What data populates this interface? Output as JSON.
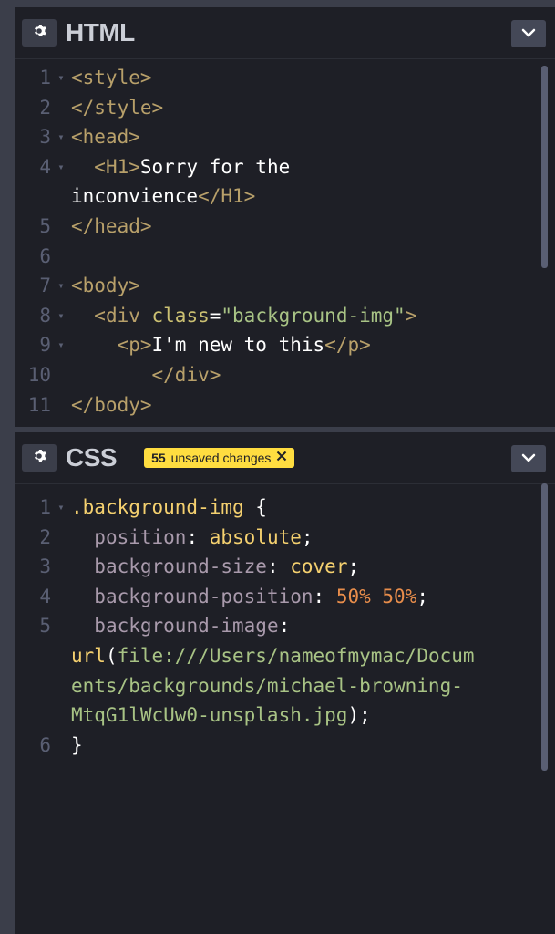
{
  "html_pane": {
    "title": "HTML",
    "lines": [
      {
        "n": "1",
        "fold": true,
        "parts": [
          {
            "c": "tag",
            "t": "<style>"
          }
        ]
      },
      {
        "n": "2",
        "fold": false,
        "parts": [
          {
            "c": "tag",
            "t": "</style>"
          }
        ]
      },
      {
        "n": "3",
        "fold": true,
        "parts": [
          {
            "c": "tag",
            "t": "<head>"
          }
        ]
      },
      {
        "n": "4",
        "fold": true,
        "parts": [
          {
            "c": "plain",
            "t": "  "
          },
          {
            "c": "tag",
            "t": "<H1>"
          },
          {
            "c": "plain",
            "t": "Sorry for the"
          }
        ]
      },
      {
        "n": "",
        "fold": false,
        "parts": [
          {
            "c": "plain",
            "t": "inconvience"
          },
          {
            "c": "tag",
            "t": "</H1>"
          }
        ]
      },
      {
        "n": "5",
        "fold": false,
        "parts": [
          {
            "c": "tag",
            "t": "</head>"
          }
        ]
      },
      {
        "n": "6",
        "fold": false,
        "parts": []
      },
      {
        "n": "7",
        "fold": true,
        "parts": [
          {
            "c": "tag",
            "t": "<body>"
          }
        ]
      },
      {
        "n": "8",
        "fold": true,
        "parts": [
          {
            "c": "plain",
            "t": "  "
          },
          {
            "c": "tag",
            "t": "<div "
          },
          {
            "c": "attr",
            "t": "class"
          },
          {
            "c": "plain",
            "t": "="
          },
          {
            "c": "str",
            "t": "\"background-img\""
          },
          {
            "c": "tag",
            "t": ">"
          }
        ]
      },
      {
        "n": "9",
        "fold": true,
        "parts": [
          {
            "c": "plain",
            "t": "    "
          },
          {
            "c": "tag",
            "t": "<p>"
          },
          {
            "c": "plain",
            "t": "I'm new to this"
          },
          {
            "c": "tag",
            "t": "</p>"
          }
        ]
      },
      {
        "n": "10",
        "fold": false,
        "parts": [
          {
            "c": "plain",
            "t": "       "
          },
          {
            "c": "tag",
            "t": "</div>"
          }
        ]
      },
      {
        "n": "11",
        "fold": false,
        "parts": [
          {
            "c": "tag",
            "t": "</body>"
          }
        ]
      }
    ]
  },
  "css_pane": {
    "title": "CSS",
    "badge_count": "55",
    "badge_label": "unsaved changes",
    "lines": [
      {
        "n": "1",
        "fold": true,
        "parts": [
          {
            "c": "sel",
            "t": ".background-img"
          },
          {
            "c": "plain",
            "t": " {"
          }
        ]
      },
      {
        "n": "2",
        "fold": false,
        "parts": [
          {
            "c": "plain",
            "t": "  "
          },
          {
            "c": "prop",
            "t": "position"
          },
          {
            "c": "plain",
            "t": ": "
          },
          {
            "c": "val",
            "t": "absolute"
          },
          {
            "c": "plain",
            "t": ";"
          }
        ]
      },
      {
        "n": "3",
        "fold": false,
        "parts": [
          {
            "c": "plain",
            "t": "  "
          },
          {
            "c": "prop",
            "t": "background-size"
          },
          {
            "c": "plain",
            "t": ": "
          },
          {
            "c": "val",
            "t": "cover"
          },
          {
            "c": "plain",
            "t": ";"
          }
        ]
      },
      {
        "n": "4",
        "fold": false,
        "parts": [
          {
            "c": "plain",
            "t": "  "
          },
          {
            "c": "prop",
            "t": "background-position"
          },
          {
            "c": "plain",
            "t": ": "
          },
          {
            "c": "num",
            "t": "50% 50%"
          },
          {
            "c": "plain",
            "t": ";"
          }
        ]
      },
      {
        "n": "5",
        "fold": false,
        "parts": [
          {
            "c": "plain",
            "t": "  "
          },
          {
            "c": "prop",
            "t": "background-image"
          },
          {
            "c": "plain",
            "t": ":"
          }
        ]
      },
      {
        "n": "",
        "fold": false,
        "parts": [
          {
            "c": "fn",
            "t": "url"
          },
          {
            "c": "plain",
            "t": "("
          },
          {
            "c": "url",
            "t": "file:///Users/nameofmymac/Docum"
          }
        ]
      },
      {
        "n": "",
        "fold": false,
        "parts": [
          {
            "c": "url",
            "t": "ents/backgrounds/michael-browning-"
          }
        ]
      },
      {
        "n": "",
        "fold": false,
        "parts": [
          {
            "c": "url",
            "t": "MtqG1lWcUw0-unsplash.jpg"
          },
          {
            "c": "plain",
            "t": ");"
          }
        ]
      },
      {
        "n": "6",
        "fold": false,
        "parts": [
          {
            "c": "plain",
            "t": "}"
          }
        ]
      }
    ]
  }
}
